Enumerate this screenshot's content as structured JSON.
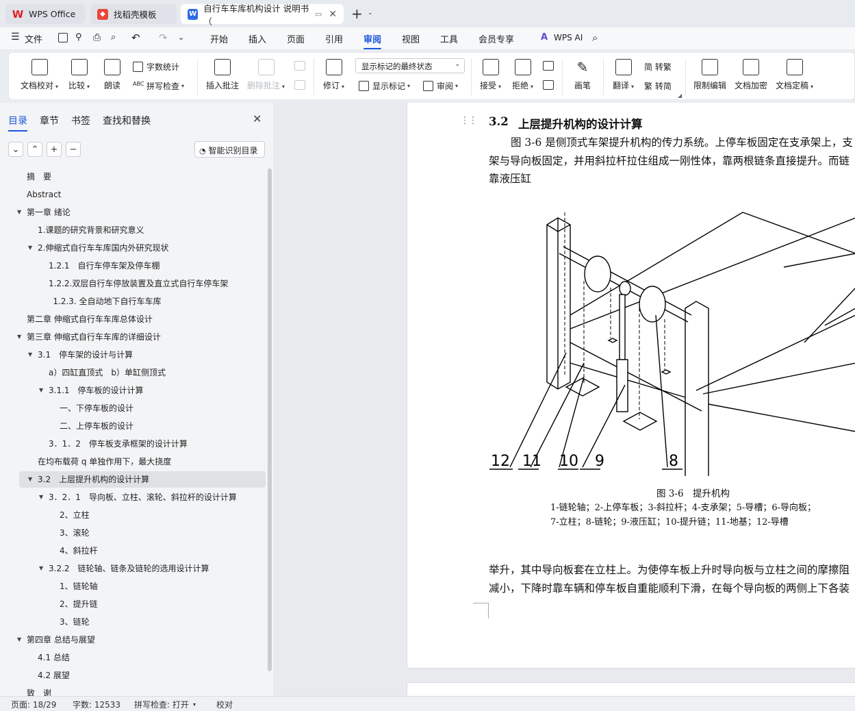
{
  "tabs": [
    {
      "label": "WPS Office",
      "icon": "wps-logo-icon"
    },
    {
      "label": "找稻壳模板",
      "icon": "docer-icon"
    },
    {
      "label": "自行车车库机构设计 说明书（",
      "icon": "word-doc-icon"
    }
  ],
  "menu": {
    "file": "文件",
    "items": [
      "开始",
      "插入",
      "页面",
      "引用",
      "审阅",
      "视图",
      "工具",
      "会员专享"
    ],
    "active": "审阅",
    "ai": "WPS AI"
  },
  "ribbon": {
    "proofread": "文档校对",
    "compare": "比较",
    "read": "朗读",
    "wordcount": "字数统计",
    "spellcheck": "拼写检查",
    "insert_comment": "插入批注",
    "delete_comment": "删除批注",
    "revise": "修订",
    "markup_state": "显示标记的最终状态",
    "show_markup": "显示标记",
    "review": "审阅",
    "accept": "接受",
    "reject": "拒绝",
    "pen": "画笔",
    "translate": "翻译",
    "to_traditional": "简 转繁",
    "to_simplified": "繁 转简",
    "restrict": "限制编辑",
    "encrypt": "文档加密",
    "finalize": "文档定稿"
  },
  "panel": {
    "tabs": [
      "目录",
      "章节",
      "书签",
      "查找和替换"
    ],
    "smart_toc": "智能识别目录",
    "toc": [
      {
        "text": "摘　要",
        "indent": 0,
        "tri": ""
      },
      {
        "text": "Abstract",
        "indent": 0,
        "tri": ""
      },
      {
        "text": "第一章  绪论",
        "indent": 0,
        "tri": "down"
      },
      {
        "text": "1.课题的研究背景和研究意义",
        "indent": 1,
        "tri": ""
      },
      {
        "text": "2.伸缩式自行车车库国内外研究现状",
        "indent": 1,
        "tri": "down"
      },
      {
        "text": "1.2.1　自行车停车架及停车棚",
        "indent": 2,
        "tri": ""
      },
      {
        "text": "1.2.2.双层自行车停放装置及直立式自行车停车架",
        "indent": 2,
        "tri": ""
      },
      {
        "text": "1.2.3. 全自动地下自行车车库",
        "indent": 2.4,
        "tri": ""
      },
      {
        "text": "第二章  伸缩式自行车车库总体设计",
        "indent": 0,
        "tri": ""
      },
      {
        "text": "第三章  伸缩式自行车车库的详细设计",
        "indent": 0,
        "tri": "down"
      },
      {
        "text": "3.1　停车架的设计与计算",
        "indent": 1,
        "tri": "down"
      },
      {
        "text": "a）四缸直顶式　b）单缸侧顶式",
        "indent": 2,
        "tri": ""
      },
      {
        "text": "3.1.1　停车板的设计计算",
        "indent": 2,
        "tri": "down"
      },
      {
        "text": "一、下停车板的设计",
        "indent": 3,
        "tri": ""
      },
      {
        "text": "二、上停车板的设计",
        "indent": 3,
        "tri": ""
      },
      {
        "text": "3．1．2　停车板支承框架的设计计算",
        "indent": 2,
        "tri": ""
      },
      {
        "text": "在均布载荷 q 单独作用下，最大挠度",
        "indent": 1,
        "tri": ""
      },
      {
        "text": "3.2　上层提升机构的设计计算",
        "indent": 1,
        "tri": "down",
        "selected": true
      },
      {
        "text": "3．2．1　导向板、立柱、滚轮、斜拉杆的设计计算",
        "indent": 2,
        "tri": "down"
      },
      {
        "text": "2、立柱",
        "indent": 3,
        "tri": ""
      },
      {
        "text": "3、滚轮",
        "indent": 3,
        "tri": ""
      },
      {
        "text": "4、斜拉杆",
        "indent": 3,
        "tri": ""
      },
      {
        "text": "3.2.2　链轮轴、链条及链轮的选用设计计算",
        "indent": 2,
        "tri": "down"
      },
      {
        "text": "1、链轮轴",
        "indent": 3,
        "tri": ""
      },
      {
        "text": "2、提升链",
        "indent": 3,
        "tri": ""
      },
      {
        "text": "3、链轮",
        "indent": 3,
        "tri": ""
      },
      {
        "text": "第四章  总结与展望",
        "indent": 0,
        "tri": "down"
      },
      {
        "text": "4.1  总结",
        "indent": 1,
        "tri": ""
      },
      {
        "text": "4.2  展望",
        "indent": 1,
        "tri": ""
      },
      {
        "text": "致　谢",
        "indent": 0,
        "tri": ""
      }
    ]
  },
  "doc": {
    "heading_num": "3.2",
    "heading": "上层提升机构的设计计算",
    "para1_l1": "图 3-6 是侧顶式车架提升机构的传力系统。上停车板固定在支承架上，支",
    "para1_l2": "架与导向板固定，并用斜拉杆拉住组成一刚性体，靠两根链条直接提升。而链",
    "para1_l3": "靠液压缸",
    "fig_labels": [
      "12",
      "11",
      "10",
      "9",
      "8"
    ],
    "caption_title": "图 3-6　提升机构",
    "caption_l1": "1-链轮轴；2-上停车板；3-斜拉杆；4-支承架；5-导槽；6-导向板；",
    "caption_l2": "7-立柱；8-链轮；9-液压缸；10-提升链；11-地基；12-导槽",
    "para2_l1": "举升，其中导向板套在立柱上。为使停车板上升时导向板与立柱之间的摩擦阻",
    "para2_l2": "减小，下降时靠车辆和停车板自重能顺利下滑，在每个导向板的两侧上下各装"
  },
  "status": {
    "page": "页面: 18/29",
    "words": "字数: 12533",
    "spell": "拼写检查: 打开",
    "proof": "校对"
  }
}
